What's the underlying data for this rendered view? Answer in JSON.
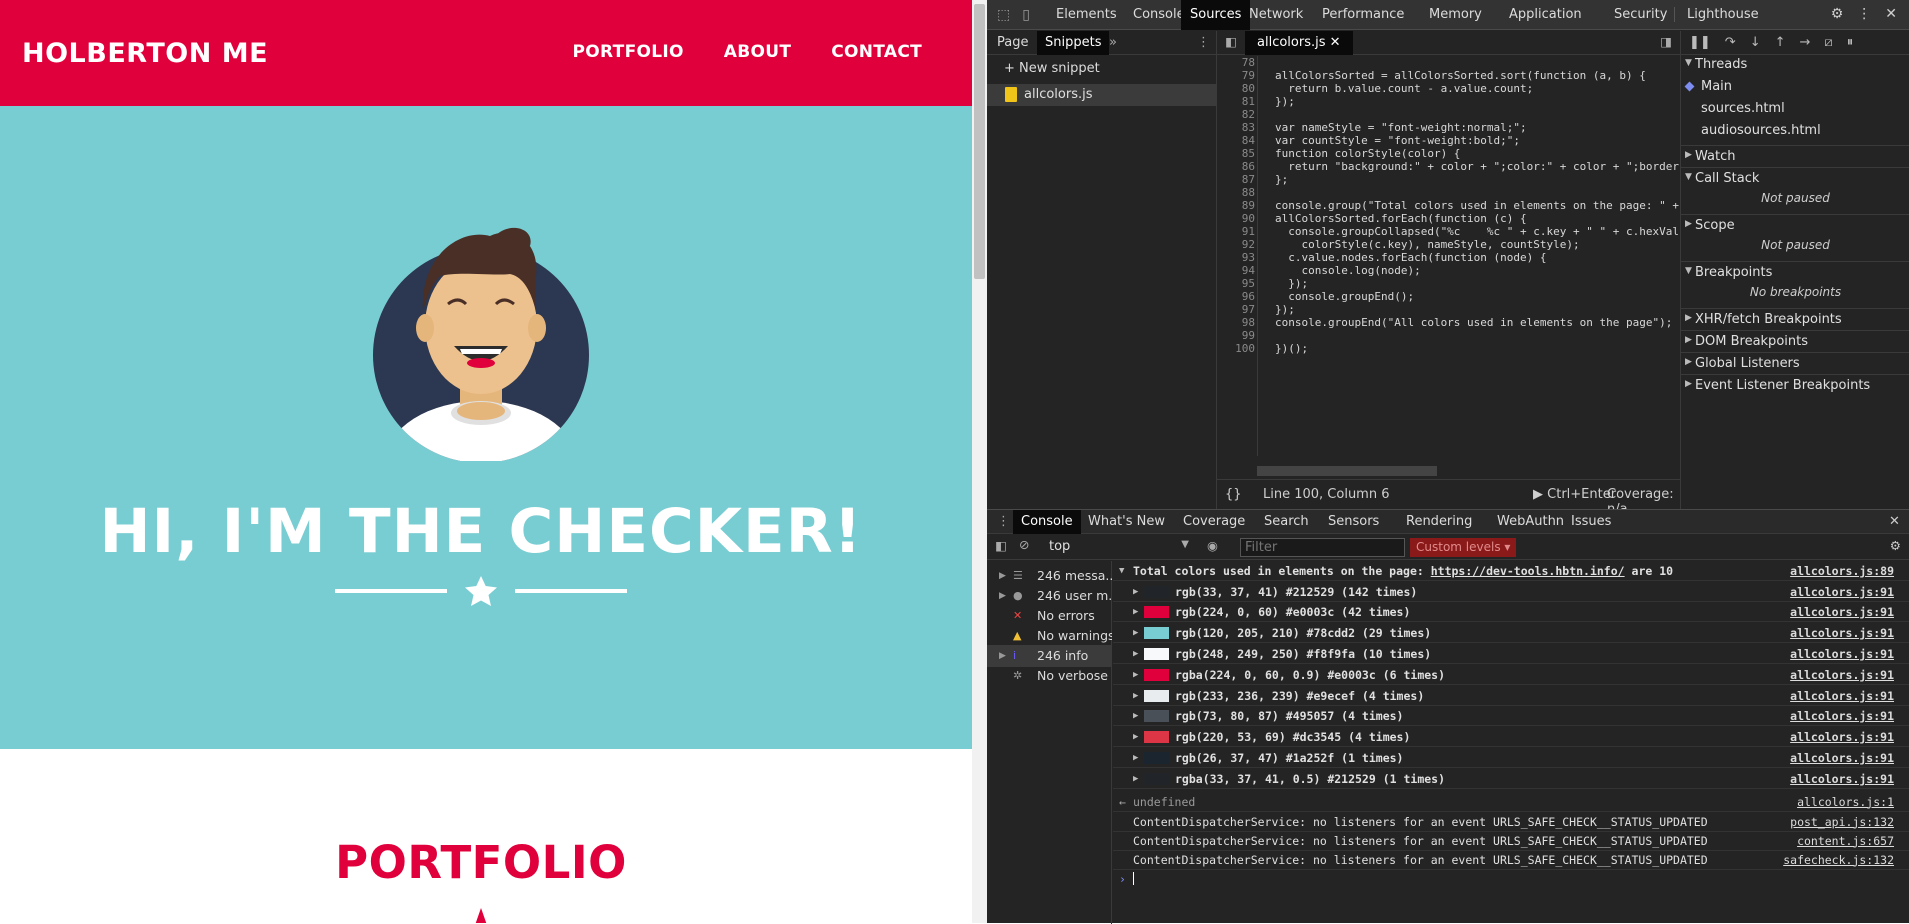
{
  "site": {
    "brand": "HOLBERTON ME",
    "nav": [
      "PORTFOLIO",
      "ABOUT",
      "CONTACT"
    ],
    "hero_title": "HI, I'M THE CHECKER!",
    "section_title": "PORTFOLIO"
  },
  "devtools": {
    "tabs": [
      "Elements",
      "Console",
      "Sources",
      "Network",
      "Performance",
      "Memory",
      "Application",
      "Security",
      "Lighthouse"
    ],
    "active_tab": "Sources",
    "nav_subtabs": [
      "Page",
      "Snippets"
    ],
    "new_snippet": "New snippet",
    "snippet_file": "allcolors.js",
    "editor_tab": "allcolors.js",
    "code_lines": [
      {
        "n": "78",
        "t": ""
      },
      {
        "n": "79",
        "t": "allColorsSorted = allColorsSorted.sort(function (a, b) {"
      },
      {
        "n": "80",
        "t": "  return b.value.count - a.value.count;"
      },
      {
        "n": "81",
        "t": "});"
      },
      {
        "n": "82",
        "t": ""
      },
      {
        "n": "83",
        "t": "var nameStyle = \"font-weight:normal;\";"
      },
      {
        "n": "84",
        "t": "var countStyle = \"font-weight:bold;\";"
      },
      {
        "n": "85",
        "t": "function colorStyle(color) {"
      },
      {
        "n": "86",
        "t": "  return \"background:\" + color + \";color:\" + color + \";border"
      },
      {
        "n": "87",
        "t": "};"
      },
      {
        "n": "88",
        "t": ""
      },
      {
        "n": "89",
        "t": "console.group(\"Total colors used in elements on the page: \" +"
      },
      {
        "n": "90",
        "t": "allColorsSorted.forEach(function (c) {"
      },
      {
        "n": "91",
        "t": "  console.groupCollapsed(\"%c    %c \" + c.key + \" \" + c.hexVal"
      },
      {
        "n": "92",
        "t": "    colorStyle(c.key), nameStyle, countStyle);"
      },
      {
        "n": "93",
        "t": "  c.value.nodes.forEach(function (node) {"
      },
      {
        "n": "94",
        "t": "    console.log(node);"
      },
      {
        "n": "95",
        "t": "  });"
      },
      {
        "n": "96",
        "t": "  console.groupEnd();"
      },
      {
        "n": "97",
        "t": "});"
      },
      {
        "n": "98",
        "t": "console.groupEnd(\"All colors used in elements on the page\");"
      },
      {
        "n": "99",
        "t": ""
      },
      {
        "n": "100",
        "t": "})();"
      }
    ],
    "status": {
      "position": "Line 100, Column 6",
      "run": "Ctrl+Enter",
      "coverage": "Coverage: n/a",
      "braces": "{}"
    },
    "debugger": {
      "threads": "Threads",
      "main": "Main",
      "thread_items": [
        "sources.html",
        "audiosources.html"
      ],
      "watch": "Watch",
      "call_stack": "Call Stack",
      "not_paused": "Not paused",
      "scope": "Scope",
      "breakpoints": "Breakpoints",
      "no_breakpoints": "No breakpoints",
      "xhr": "XHR/fetch Breakpoints",
      "dom": "DOM Breakpoints",
      "global": "Global Listeners",
      "event": "Event Listener Breakpoints"
    },
    "drawer_tabs": [
      "Console",
      "What's New",
      "Coverage",
      "Search",
      "Sensors",
      "Rendering",
      "WebAuthn",
      "Issues"
    ],
    "context": "top",
    "filter_placeholder": "Filter",
    "custom_levels": "Custom levels ▾",
    "sidebar": [
      {
        "label": "246 messa...",
        "icon": "list"
      },
      {
        "label": "246 user m...",
        "icon": "user"
      },
      {
        "label": "No errors",
        "icon": "error"
      },
      {
        "label": "No warnings",
        "icon": "warning"
      },
      {
        "label": "246 info",
        "icon": "info"
      },
      {
        "label": "No verbose",
        "icon": "verbose"
      }
    ],
    "group_header": {
      "prefix": "Total colors used in elements on the page: ",
      "link": "https://dev-tools.hbtn.info/",
      "suffix": " are 10",
      "src": "allcolors.js:89"
    },
    "colors": [
      {
        "label": "rgb(33, 37, 41) #212529 (142 times)",
        "swatch": "#212529",
        "src": "allcolors.js:91"
      },
      {
        "label": "rgb(224, 0, 60) #e0003c (42 times)",
        "swatch": "#e0003c",
        "src": "allcolors.js:91"
      },
      {
        "label": "rgb(120, 205, 210) #78cdd2 (29 times)",
        "swatch": "#78cdd2",
        "src": "allcolors.js:91"
      },
      {
        "label": "rgb(248, 249, 250) #f8f9fa (10 times)",
        "swatch": "#f8f9fa",
        "src": "allcolors.js:91"
      },
      {
        "label": "rgba(224, 0, 60, 0.9) #e0003c (6 times)",
        "swatch": "#e0003c",
        "src": "allcolors.js:91"
      },
      {
        "label": "rgb(233, 236, 239) #e9ecef (4 times)",
        "swatch": "#e9ecef",
        "src": "allcolors.js:91"
      },
      {
        "label": "rgb(73, 80, 87) #495057 (4 times)",
        "swatch": "#495057",
        "src": "allcolors.js:91"
      },
      {
        "label": "rgb(220, 53, 69) #dc3545 (4 times)",
        "swatch": "#dc3545",
        "src": "allcolors.js:91"
      },
      {
        "label": "rgb(26, 37, 47) #1a252f (1 times)",
        "swatch": "#1a252f",
        "src": "allcolors.js:91"
      },
      {
        "label": "rgba(33, 37, 41, 0.5) #212529 (1 times)",
        "swatch": "#212529",
        "src": "allcolors.js:91"
      }
    ],
    "result": {
      "text": "undefined",
      "src": "allcolors.js:1"
    },
    "logs": [
      {
        "text": "ContentDispatcherService: no listeners for an event URLS_SAFE_CHECK__STATUS_UPDATED",
        "src": "post_api.js:132"
      },
      {
        "text": "ContentDispatcherService: no listeners for an event URLS_SAFE_CHECK__STATUS_UPDATED",
        "src": "content.js:657"
      },
      {
        "text": "ContentDispatcherService: no listeners for an event URLS_SAFE_CHECK__STATUS_UPDATED",
        "src": "safecheck.js:132"
      }
    ]
  },
  "colors": {
    "brand_red": "#e0003c",
    "teal": "#78cdd2"
  }
}
